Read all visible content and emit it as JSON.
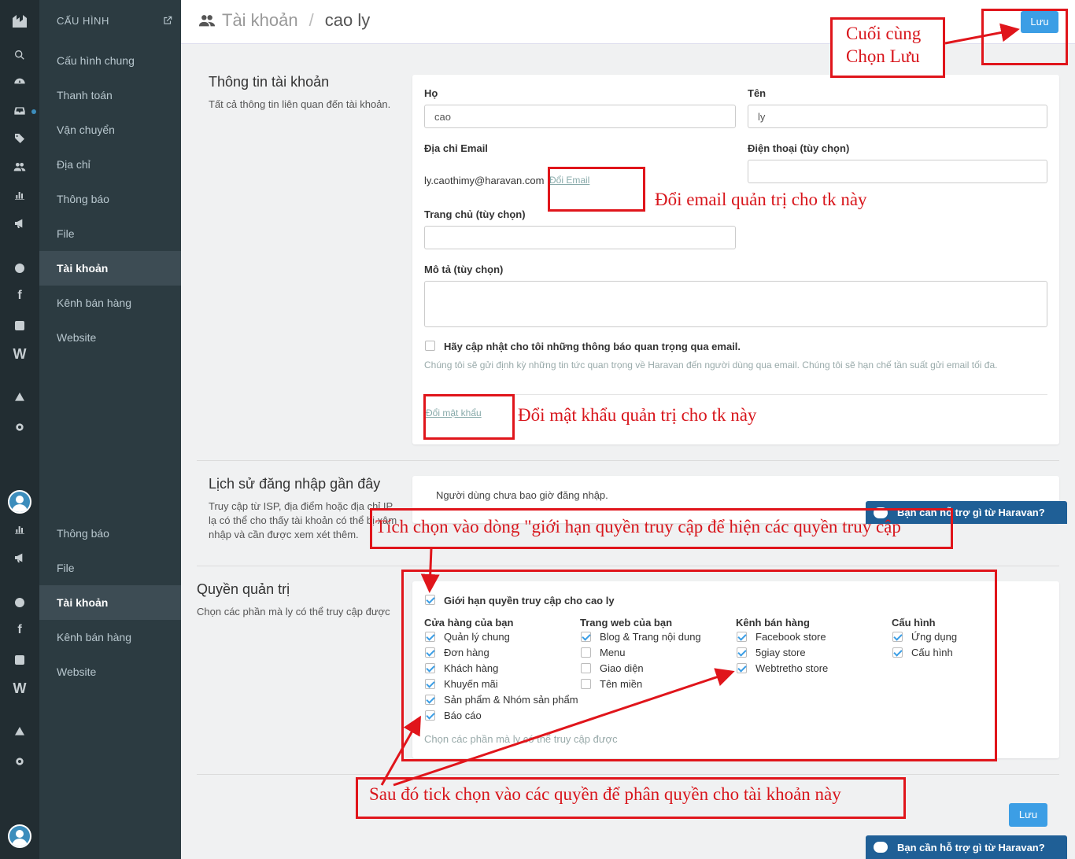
{
  "sidebar": {
    "header": "CẤU HÌNH",
    "items": [
      "Cấu hình chung",
      "Thanh toán",
      "Vận chuyển",
      "Địa chỉ",
      "Thông báo",
      "File",
      "Tài khoản",
      "Kênh bán hàng",
      "Website"
    ],
    "items_repeat": [
      "Thông báo",
      "File",
      "Tài khoản",
      "Kênh bán hàng",
      "Website"
    ]
  },
  "header": {
    "section": "Tài khoản",
    "current": "cao ly",
    "save_label": "Lưu"
  },
  "account": {
    "title": "Thông tin tài khoản",
    "desc": "Tất cả thông tin liên quan đến tài khoản.",
    "ho_label": "Họ",
    "ho_value": "cao",
    "ten_label": "Tên",
    "ten_value": "ly",
    "email_label": "Địa chỉ Email",
    "email_value": "ly.caothimy@haravan.com",
    "change_email": "Đổi Email",
    "phone_label": "Điện thoại (tùy chọn)",
    "homepage_label": "Trang chủ (tùy chọn)",
    "desc_label": "Mô tả (tùy chọn)",
    "notify_label": "Hãy cập nhật cho tôi những thông báo quan trọng qua email.",
    "notify_help": "Chúng tôi sẽ gửi định kỳ những tin tức quan trọng về Haravan đến người dùng qua email. Chúng tôi sẽ hạn chế tần suất gửi email tối đa.",
    "change_password": "Đổi mật khẩu"
  },
  "history": {
    "title": "Lịch sử đăng nhập gần đây",
    "desc": "Truy cập từ ISP, địa điểm hoặc địa chỉ IP lạ có thể cho thấy tài khoản có thể bị xâm nhập và cần được xem xét thêm.",
    "empty": "Người dùng chưa bao giờ đăng nhập."
  },
  "permissions": {
    "title": "Quyền quản trị",
    "desc": "Chọn các phần mà ly có thể truy cập được",
    "limit_label": "Giới hạn quyền truy cập cho cao ly",
    "groups": [
      {
        "title": "Cửa hàng của bạn",
        "items": [
          {
            "label": "Quản lý chung",
            "checked": true
          },
          {
            "label": "Đơn hàng",
            "checked": true
          },
          {
            "label": "Khách hàng",
            "checked": true
          },
          {
            "label": "Khuyến mãi",
            "checked": true
          },
          {
            "label": "Sản phẩm & Nhóm sản phẩm",
            "checked": true
          },
          {
            "label": "Báo cáo",
            "checked": true
          }
        ]
      },
      {
        "title": "Trang web của bạn",
        "items": [
          {
            "label": "Blog & Trang nội dung",
            "checked": true
          },
          {
            "label": "Menu",
            "checked": false
          },
          {
            "label": "Giao diện",
            "checked": false
          },
          {
            "label": "Tên miền",
            "checked": false
          }
        ]
      },
      {
        "title": "Kênh bán hàng",
        "items": [
          {
            "label": "Facebook store",
            "checked": true
          },
          {
            "label": "5giay store",
            "checked": true
          },
          {
            "label": "Webtretho store",
            "checked": true
          }
        ]
      },
      {
        "title": "Cấu hình",
        "items": [
          {
            "label": "Ứng dụng",
            "checked": true
          },
          {
            "label": "Cấu hình",
            "checked": true
          }
        ]
      }
    ],
    "help": "Chọn các phần mà ly có thể truy cập được"
  },
  "support_label": "Bạn cần hỗ trợ gì từ Haravan?",
  "annotations": {
    "save_note_1": "Cuối cùng",
    "save_note_2": "Chọn Lưu",
    "email_note": "Đổi email quản trị cho tk này",
    "password_note": "Đổi mật khẩu quản trị cho tk này",
    "limit_note": "Tích chọn vào dòng  \"giới hạn quyền truy cập để hiện các quyền truy cập",
    "perm_note": "Sau đó tick chọn vào các quyền để phân quyền cho tài khoản này"
  }
}
